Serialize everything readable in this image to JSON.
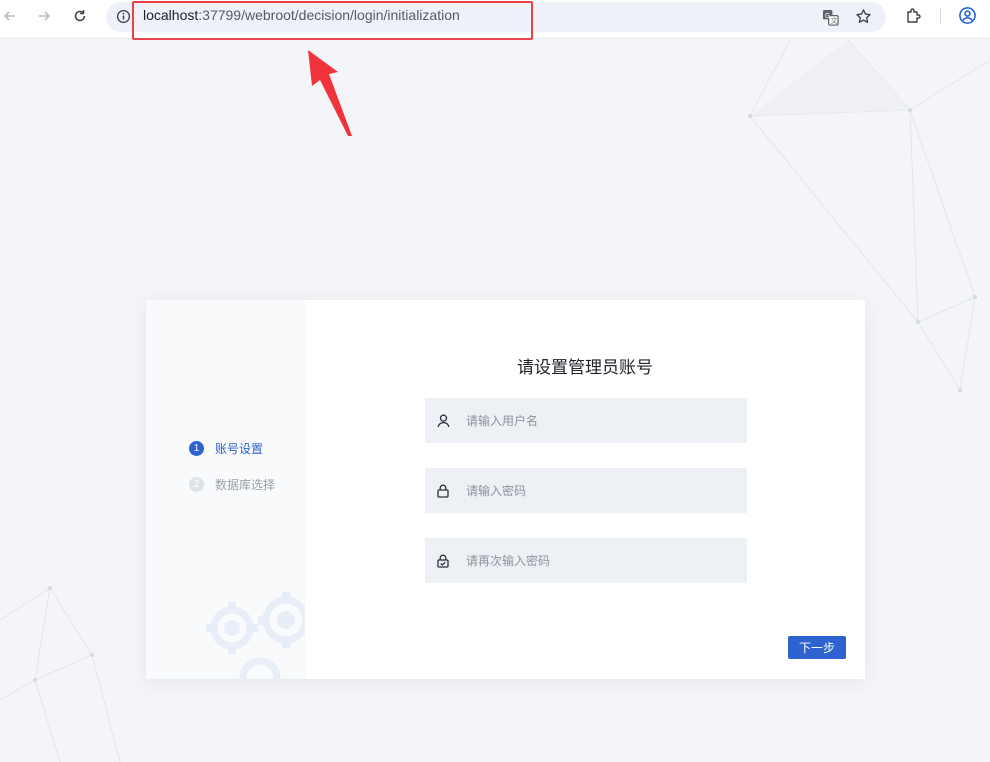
{
  "browser": {
    "url_host": "localhost",
    "url_path": ":37799/webroot/decision/login/initialization",
    "icons": [
      "back-icon",
      "forward-icon",
      "reload-icon",
      "info-icon",
      "translate-icon",
      "star-icon",
      "extensions-icon",
      "profile-icon"
    ]
  },
  "annotation": {
    "color": "#e8424a"
  },
  "wizard": {
    "steps": [
      {
        "num": "1",
        "label": "账号设置"
      },
      {
        "num": "2",
        "label": "数据库选择"
      }
    ],
    "title": "请设置管理员账号",
    "fields": {
      "username": {
        "placeholder": "请输入用户名",
        "value": ""
      },
      "password": {
        "placeholder": "请输入密码",
        "value": ""
      },
      "confirm": {
        "placeholder": "请再次输入密码",
        "value": ""
      }
    },
    "next_label": "下一步",
    "accent": "#2f62d1"
  }
}
